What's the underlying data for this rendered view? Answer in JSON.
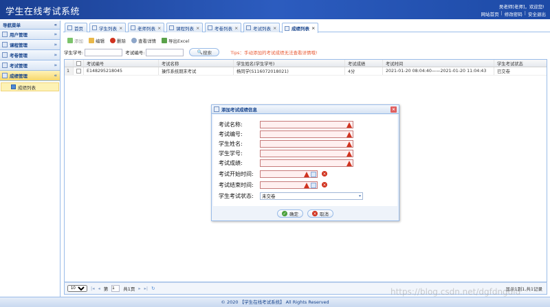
{
  "app": {
    "title": "学生在线考试系统",
    "welcome": "吴老师[老师]，欢迎您!",
    "links": [
      "网站首页",
      "修改密码",
      "安全退出"
    ]
  },
  "sidebar": {
    "title": "导航菜单",
    "collapse": "«",
    "groups": [
      {
        "label": "用户管理",
        "chev": "»"
      },
      {
        "label": "课程管理",
        "chev": "»"
      },
      {
        "label": "考卷管理",
        "chev": "»"
      },
      {
        "label": "考试管理",
        "chev": "»"
      },
      {
        "label": "成绩管理",
        "chev": "«"
      }
    ],
    "active_sub": "成绩列表"
  },
  "tabs": [
    {
      "label": "首页",
      "closable": false
    },
    {
      "label": "学生列表",
      "closable": true
    },
    {
      "label": "老师列表",
      "closable": true
    },
    {
      "label": "课程列表",
      "closable": true
    },
    {
      "label": "考卷列表",
      "closable": true
    },
    {
      "label": "考试列表",
      "closable": true
    },
    {
      "label": "成绩列表",
      "closable": true,
      "active": true
    }
  ],
  "toolbar": {
    "add": "添加",
    "edit": "编辑",
    "delete": "删除",
    "view": "查看详情",
    "export": "导出Excel"
  },
  "search": {
    "student_id_label": "学生学号:",
    "exam_id_label": "考试编号:",
    "search_button": "搜索",
    "tips": "Tips：手动添加的考试成绩无法查看详情哦!"
  },
  "grid": {
    "columns": [
      "考试编号",
      "考试名称",
      "学生姓名(学生学号)",
      "考试成绩",
      "考试时间",
      "学生考试状态"
    ],
    "rows": [
      {
        "num": "1",
        "exam_id": "E148295218045",
        "exam_name": "操作系统期末考试",
        "student": "杨同学(S116072018021)",
        "score": "4分",
        "time": "2021-01-20 08:04:40——2021-01-20 11:04:43",
        "status": "已交卷"
      }
    ]
  },
  "pager": {
    "page_size": "10",
    "page_prefix": "第",
    "page_value": "1",
    "page_suffix": "共1页",
    "info": "显示1到1,共1记录"
  },
  "footer": "© 2020 【学生在线考试系统】 All Rights Reserved",
  "dialog": {
    "title": "添加考试成绩信息",
    "fields": {
      "exam_name": "考试名称:",
      "exam_id": "考试编号:",
      "student_name": "学生姓名:",
      "student_id": "学生学号:",
      "score": "考试成绩:",
      "start_time": "考试开始时间:",
      "end_time": "考试结束时间:",
      "status": "学生考试状态:"
    },
    "status_value": "未交卷",
    "ok": "确定",
    "cancel": "取消"
  },
  "watermark": "https://blog.csdn.net/dgfdngdid"
}
